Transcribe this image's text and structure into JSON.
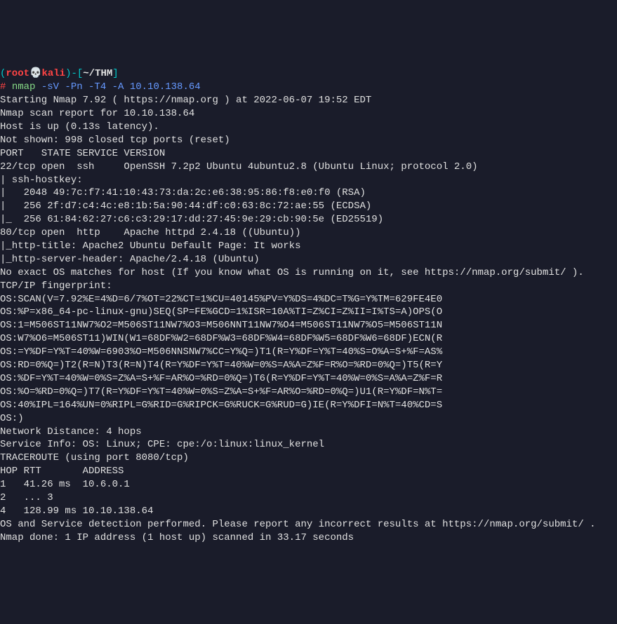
{
  "prompt": {
    "open_paren": "(",
    "user": "root",
    "skull": "💀",
    "host": "kali",
    "close_paren": ")-",
    "open_bracket": "[",
    "tilde": "~/THM",
    "close_bracket": "]",
    "hash": "# ",
    "cmd_name": "nmap",
    "cmd_args": " -sV -Pn -T4 -A 10.10.138.64"
  },
  "out": {
    "l1": "Starting Nmap 7.92 ( https://nmap.org ) at 2022-06-07 19:52 EDT",
    "l2": "Nmap scan report for 10.10.138.64",
    "l3": "Host is up (0.13s latency).",
    "l4": "Not shown: 998 closed tcp ports (reset)",
    "l5": "PORT   STATE SERVICE VERSION",
    "l6": "22/tcp open  ssh     OpenSSH 7.2p2 Ubuntu 4ubuntu2.8 (Ubuntu Linux; protocol 2.0)",
    "l7": "| ssh-hostkey:",
    "l8": "|   2048 49:7c:f7:41:10:43:73:da:2c:e6:38:95:86:f8:e0:f0 (RSA)",
    "l9": "|   256 2f:d7:c4:4c:e8:1b:5a:90:44:df:c0:63:8c:72:ae:55 (ECDSA)",
    "l10": "|_  256 61:84:62:27:c6:c3:29:17:dd:27:45:9e:29:cb:90:5e (ED25519)",
    "l11": "80/tcp open  http    Apache httpd 2.4.18 ((Ubuntu))",
    "l12": "|_http-title: Apache2 Ubuntu Default Page: It works",
    "l13": "|_http-server-header: Apache/2.4.18 (Ubuntu)",
    "l14": "No exact OS matches for host (If you know what OS is running on it, see https://nmap.org/submit/ ).",
    "l15": "TCP/IP fingerprint:",
    "l16": "OS:SCAN(V=7.92%E=4%D=6/7%OT=22%CT=1%CU=40145%PV=Y%DS=4%DC=T%G=Y%TM=629FE4E0",
    "l17": "OS:%P=x86_64-pc-linux-gnu)SEQ(SP=FE%GCD=1%ISR=10A%TI=Z%CI=Z%II=I%TS=A)OPS(O",
    "l18": "OS:1=M506ST11NW7%O2=M506ST11NW7%O3=M506NNT11NW7%O4=M506ST11NW7%O5=M506ST11N",
    "l19": "OS:W7%O6=M506ST11)WIN(W1=68DF%W2=68DF%W3=68DF%W4=68DF%W5=68DF%W6=68DF)ECN(R",
    "l20": "OS:=Y%DF=Y%T=40%W=6903%O=M506NNSNW7%CC=Y%Q=)T1(R=Y%DF=Y%T=40%S=O%A=S+%F=AS%",
    "l21": "OS:RD=0%Q=)T2(R=N)T3(R=N)T4(R=Y%DF=Y%T=40%W=0%S=A%A=Z%F=R%O=%RD=0%Q=)T5(R=Y",
    "l22": "OS:%DF=Y%T=40%W=0%S=Z%A=S+%F=AR%O=%RD=0%Q=)T6(R=Y%DF=Y%T=40%W=0%S=A%A=Z%F=R",
    "l23": "OS:%O=%RD=0%Q=)T7(R=Y%DF=Y%T=40%W=0%S=Z%A=S+%F=AR%O=%RD=0%Q=)U1(R=Y%DF=N%T=",
    "l24": "OS:40%IPL=164%UN=0%RIPL=G%RID=G%RIPCK=G%RUCK=G%RUD=G)IE(R=Y%DFI=N%T=40%CD=S",
    "l25": "OS:)",
    "l26": "",
    "l27": "Network Distance: 4 hops",
    "l28": "Service Info: OS: Linux; CPE: cpe:/o:linux:linux_kernel",
    "l29": "",
    "l30": "TRACEROUTE (using port 8080/tcp)",
    "l31": "HOP RTT       ADDRESS",
    "l32": "1   41.26 ms  10.6.0.1",
    "l33": "2   ... 3",
    "l34": "4   128.99 ms 10.10.138.64",
    "l35": "",
    "l36": "OS and Service detection performed. Please report any incorrect results at https://nmap.org/submit/ .",
    "l37": "Nmap done: 1 IP address (1 host up) scanned in 33.17 seconds"
  }
}
